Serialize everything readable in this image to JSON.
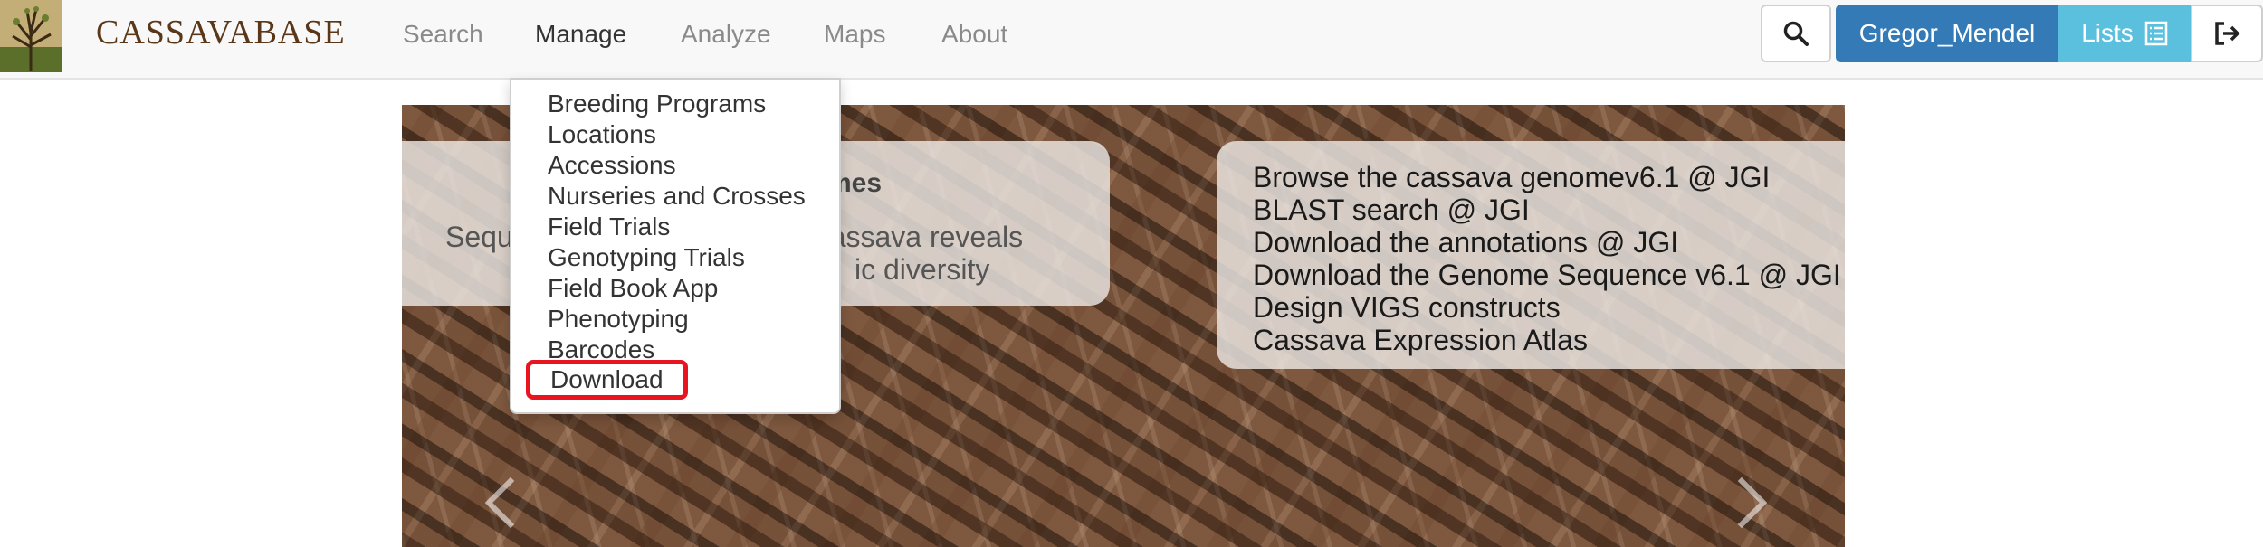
{
  "brand": {
    "name": "CASSAVABASE"
  },
  "nav": {
    "items": [
      {
        "label": "Search"
      },
      {
        "label": "Manage"
      },
      {
        "label": "Analyze"
      },
      {
        "label": "Maps"
      },
      {
        "label": "About"
      }
    ],
    "active": "Manage"
  },
  "toolbar": {
    "search_icon": "search-icon",
    "user_label": "Gregor_Mendel",
    "lists_label": "Lists",
    "lists_icon": "list-icon",
    "logout_icon": "logout-icon"
  },
  "colors": {
    "user_button": "#337ab7",
    "lists_button": "#5bc0de",
    "brand_text": "#5a3718",
    "highlight_border": "#e8141f"
  },
  "manage_menu": {
    "items": [
      {
        "label": "Breeding Programs"
      },
      {
        "label": "Locations"
      },
      {
        "label": "Accessions"
      },
      {
        "label": "Nurseries and Crosses"
      },
      {
        "label": "Field Trials"
      },
      {
        "label": "Genotyping Trials"
      },
      {
        "label": "Field Book App"
      },
      {
        "label": "Phenotyping"
      },
      {
        "label": "Barcodes"
      },
      {
        "label": "Download"
      }
    ],
    "highlighted": "Download"
  },
  "hero": {
    "left_panel": {
      "title_fragment": "mes",
      "line1_fragment": "Sequ",
      "line1_fragment_b": "d cassava reveals",
      "line2_fragment": "ic diversity"
    },
    "right_panel": {
      "links": [
        {
          "label": "Browse the cassava genomev6.1 @ JGI"
        },
        {
          "label": "BLAST search @ JGI"
        },
        {
          "label": "Download the annotations @ JGI"
        },
        {
          "label": "Download the Genome Sequence v6.1 @ JGI"
        },
        {
          "label": "Design VIGS constructs"
        },
        {
          "label": "Cassava Expression Atlas"
        }
      ]
    }
  }
}
